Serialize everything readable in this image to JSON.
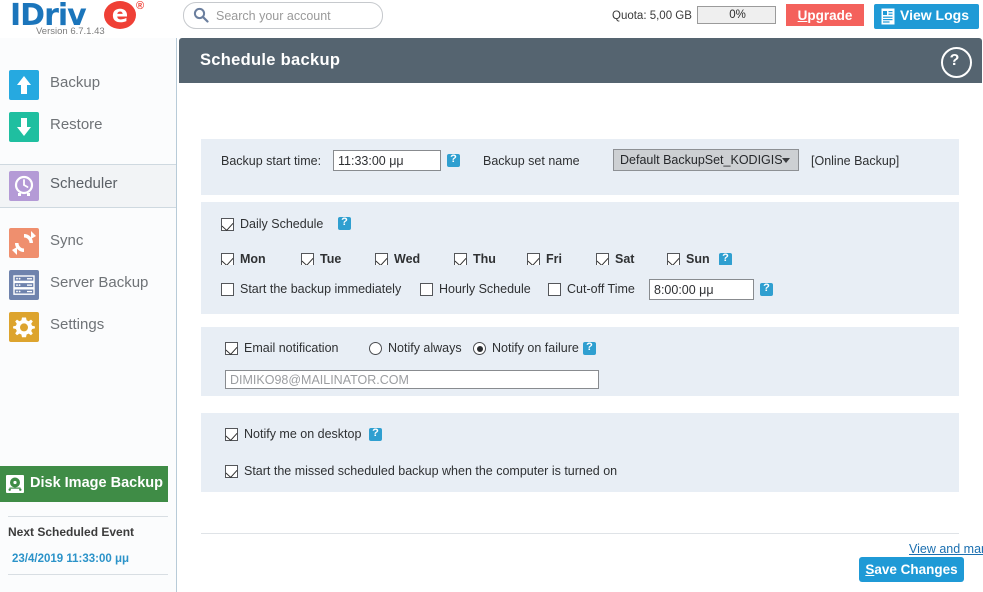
{
  "brand": {
    "name_part1": "IDriv",
    "name_e": "e",
    "registered": "®",
    "version": "Version  6.7.1.43",
    "logo_blue": "#1b75bb",
    "logo_red": "#ef4036"
  },
  "topbar": {
    "search_placeholder": "Search your account",
    "search_value": "",
    "search_icon": "search-icon",
    "quota_label": "Quota: 5,00 GB",
    "quota_percent": "0%",
    "upgrade_label_u": "U",
    "upgrade_label_rest": "pgrade",
    "viewlogs_label": "View Logs",
    "viewlogs_icon": "document-lines-icon",
    "upgrade_color": "#f4615c",
    "viewlogs_color": "#1f9ad6"
  },
  "sidebar": {
    "items": [
      {
        "label": "Backup",
        "icon": "upload-arrow-icon",
        "color": "#26a9e0",
        "active": false
      },
      {
        "label": "Restore",
        "icon": "download-arrow-icon",
        "color": "#1fbfa0",
        "active": false
      },
      {
        "label": "Scheduler",
        "icon": "clock-icon",
        "color": "#b49ad6",
        "active": true
      },
      {
        "label": "Sync",
        "icon": "sync-arrows-icon",
        "color": "#ef8f6e",
        "active": false
      },
      {
        "label": "Server Backup",
        "icon": "server-rack-icon",
        "color": "#6f83ad",
        "active": false
      },
      {
        "label": "Settings",
        "icon": "gear-icon",
        "color": "#dda42e",
        "active": false
      }
    ],
    "disk_image_backup": {
      "label": "Disk Image Backup",
      "icon": "disk-platter-icon",
      "color": "#3f8c46"
    },
    "next_event": {
      "title": "Next Scheduled Event",
      "date": "23/4/2019 11:33:00 μμ",
      "date_color": "#2b93c9"
    }
  },
  "panel": {
    "title": "Schedule  backup",
    "header_color": "#556470",
    "help_icon": "question-mark-circle-icon"
  },
  "start_time_section": {
    "label": "Backup start time:",
    "time_value": "11:33:00 μμ",
    "help_icon": "help-icon",
    "set_name_label": "Backup set name",
    "set_name_selected": "Default BackupSet_KODIGIS",
    "set_name_options": [
      "Default BackupSet_KODIGIS"
    ],
    "online_badge": "[Online Backup]"
  },
  "daily_section": {
    "daily_label": "Daily Schedule",
    "daily_checked": true,
    "help_icon": "help-icon",
    "days": [
      {
        "label": "Mon",
        "checked": true
      },
      {
        "label": "Tue",
        "checked": true
      },
      {
        "label": "Wed",
        "checked": true
      },
      {
        "label": "Thu",
        "checked": true
      },
      {
        "label": "Fri",
        "checked": true
      },
      {
        "label": "Sat",
        "checked": true
      },
      {
        "label": "Sun",
        "checked": true
      }
    ],
    "days_help_icon": "help-icon"
  },
  "options_section": {
    "immediate_label": "Start the backup immediately",
    "immediate_checked": false,
    "hourly_label": "Hourly Schedule",
    "hourly_checked": false,
    "cutoff_label": "Cut-off Time",
    "cutoff_checked": false,
    "cutoff_time_value": "8:00:00 μμ",
    "help_icon": "help-icon"
  },
  "email_section": {
    "email_label": "Email notification",
    "email_checked": true,
    "notify_always_label": "Notify always",
    "notify_always_selected": false,
    "notify_failure_label": "Notify on failure",
    "notify_failure_selected": true,
    "help_icon": "help-icon",
    "email_value": "",
    "email_placeholder": "DIMIKO98@MAILINATOR.COM"
  },
  "desktop_section": {
    "notify_desktop_label": "Notify me on desktop",
    "notify_desktop_checked": true,
    "help_icon": "help-icon",
    "missed_backup_label": "Start the missed scheduled backup when the computer is turned on",
    "missed_backup_checked": true
  },
  "footer": {
    "manage_link": "View and manage all scheduled jobs",
    "save_label_u": "S",
    "save_label_rest": "ave Changes",
    "save_color": "#1f9ad6"
  }
}
